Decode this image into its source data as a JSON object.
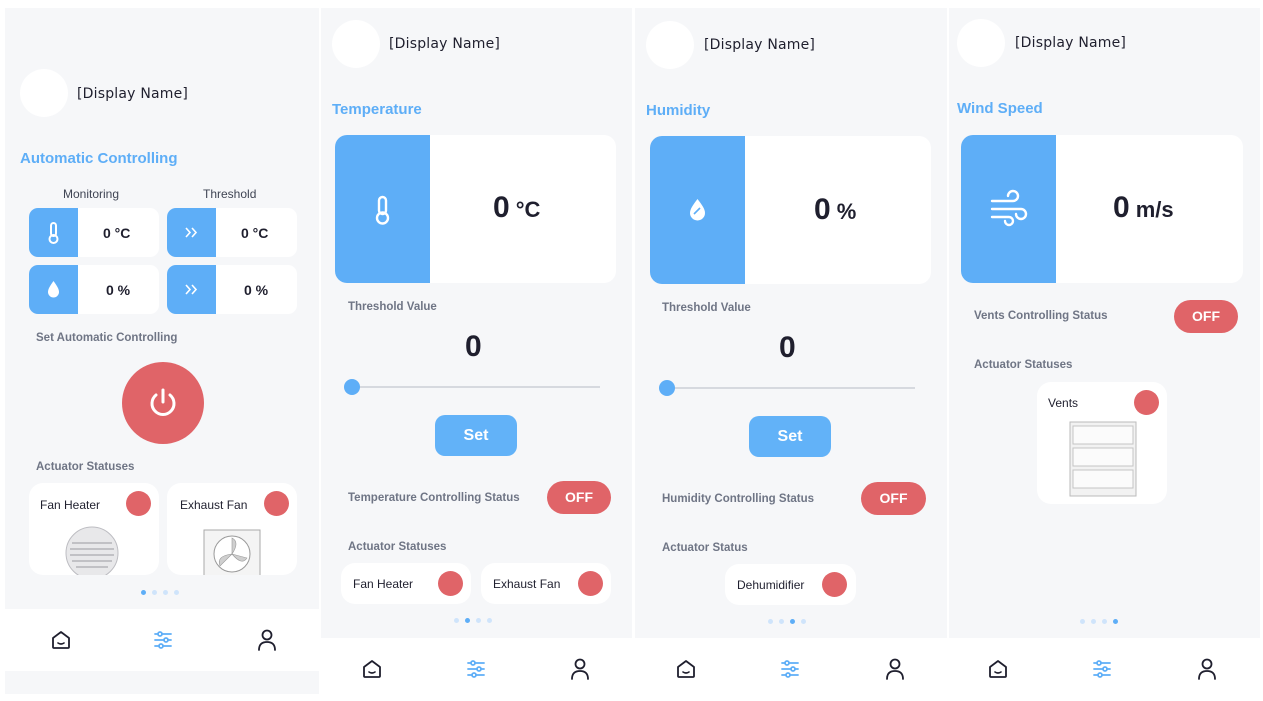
{
  "colors": {
    "accent": "#5eaef7",
    "danger": "#e06468",
    "bg": "#f6f7f9"
  },
  "user": {
    "display_name": "[Display Name]"
  },
  "nav": {
    "icons": [
      "home-icon",
      "sliders-icon",
      "user-icon"
    ]
  },
  "screen1": {
    "title": "Automatic Controlling",
    "col_monitoring": "Monitoring",
    "col_threshold": "Threshold",
    "temp_value": "0 °C",
    "temp_threshold": "0 °C",
    "hum_value": "0 %",
    "hum_threshold": "0 %",
    "set_auto_label": "Set Automatic Controlling",
    "actuators_label": "Actuator Statuses",
    "actuators": [
      "Fan Heater",
      "Exhaust Fan"
    ],
    "page_dot_active": 1
  },
  "screen2": {
    "title": "Temperature",
    "value": "0",
    "unit": "°C",
    "threshold_label": "Threshold Value",
    "threshold_value": "0",
    "set_label": "Set",
    "controlling_label": "Temperature Controlling Status",
    "status": "OFF",
    "actuators_label": "Actuator Statuses",
    "actuators": [
      "Fan Heater",
      "Exhaust Fan"
    ],
    "page_dot_active": 2
  },
  "screen3": {
    "title": "Humidity",
    "value": "0",
    "unit": "%",
    "threshold_label": "Threshold Value",
    "threshold_value": "0",
    "set_label": "Set",
    "controlling_label": "Humidity Controlling Status",
    "status": "OFF",
    "actuators_label": "Actuator Status",
    "actuators": [
      "Dehumidifier"
    ],
    "page_dot_active": 3
  },
  "screen4": {
    "title": "Wind Speed",
    "value": "0",
    "unit": "m/s",
    "controlling_label": "Vents Controlling Status",
    "status": "OFF",
    "actuators_label": "Actuator Statuses",
    "actuators": [
      "Vents"
    ],
    "page_dot_active": 4
  }
}
